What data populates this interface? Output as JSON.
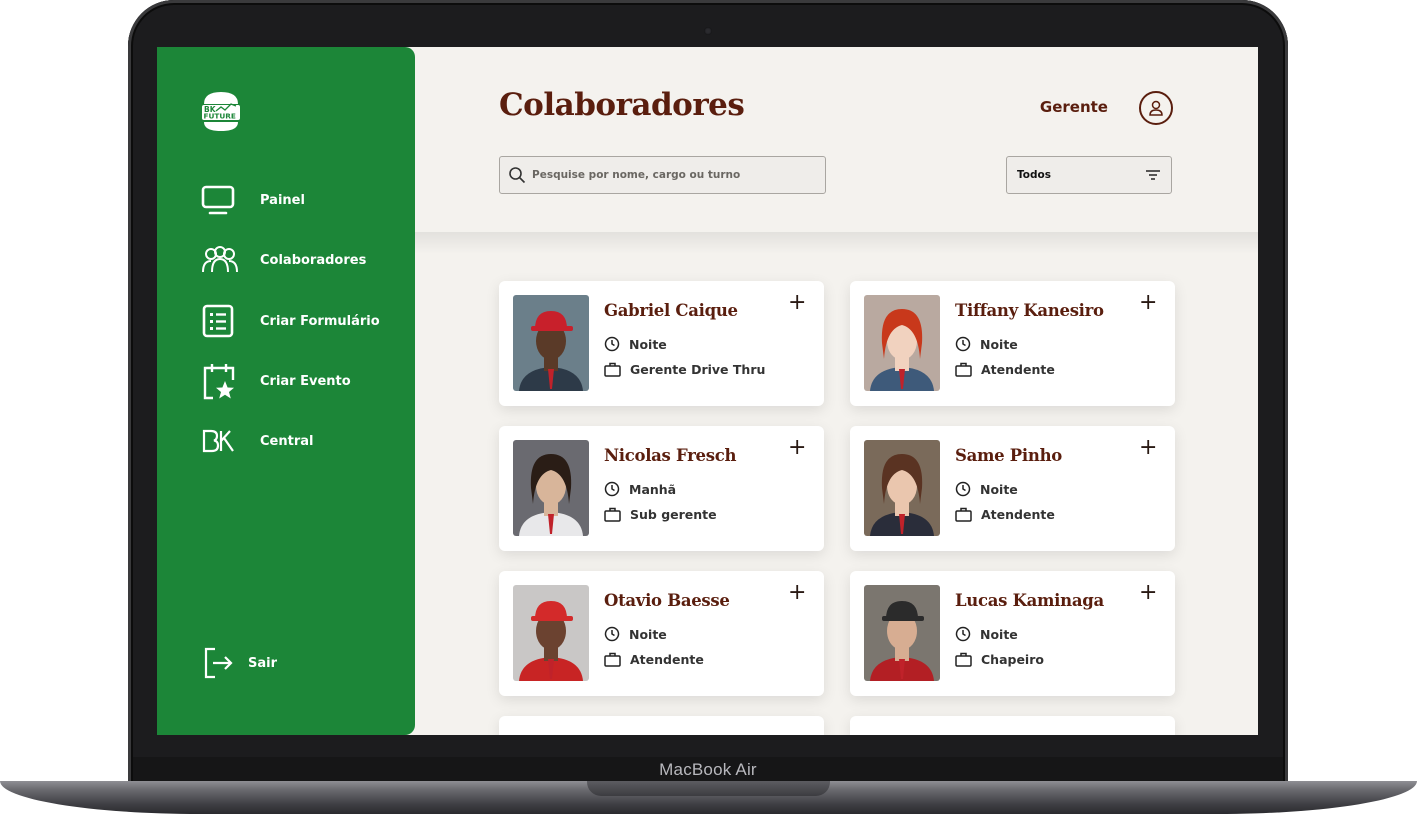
{
  "device": {
    "label": "MacBook Air"
  },
  "brand": {
    "logo_line1": "BK",
    "logo_line2": "FUTURE",
    "primary": "#1c8638",
    "accent": "#5a1e0e"
  },
  "sidebar": {
    "items": [
      {
        "label": "Painel",
        "icon": "monitor-icon"
      },
      {
        "label": "Colaboradores",
        "icon": "users-icon"
      },
      {
        "label": "Criar Formulário",
        "icon": "form-list-icon"
      },
      {
        "label": "Criar Evento",
        "icon": "calendar-star-icon"
      },
      {
        "label": "Central",
        "icon": "bk-icon"
      }
    ],
    "logout": {
      "label": "Sair",
      "icon": "logout-icon"
    }
  },
  "header": {
    "title": "Colaboradores",
    "user_role": "Gerente",
    "search": {
      "placeholder": "Pesquise por nome, cargo ou turno"
    },
    "filter": {
      "value": "Todos"
    }
  },
  "employees": [
    {
      "name": "Gabriel Caique",
      "shift": "Noite",
      "role": "Gerente Drive Thru"
    },
    {
      "name": "Tiffany Kanesiro",
      "shift": "Noite",
      "role": "Atendente"
    },
    {
      "name": "Nicolas Fresch",
      "shift": "Manhã",
      "role": "Sub gerente"
    },
    {
      "name": "Same Pinho",
      "shift": "Noite",
      "role": "Atendente"
    },
    {
      "name": "Otavio Baesse",
      "shift": "Noite",
      "role": "Atendente"
    },
    {
      "name": "Lucas Kaminaga",
      "shift": "Noite",
      "role": "Chapeiro"
    }
  ]
}
